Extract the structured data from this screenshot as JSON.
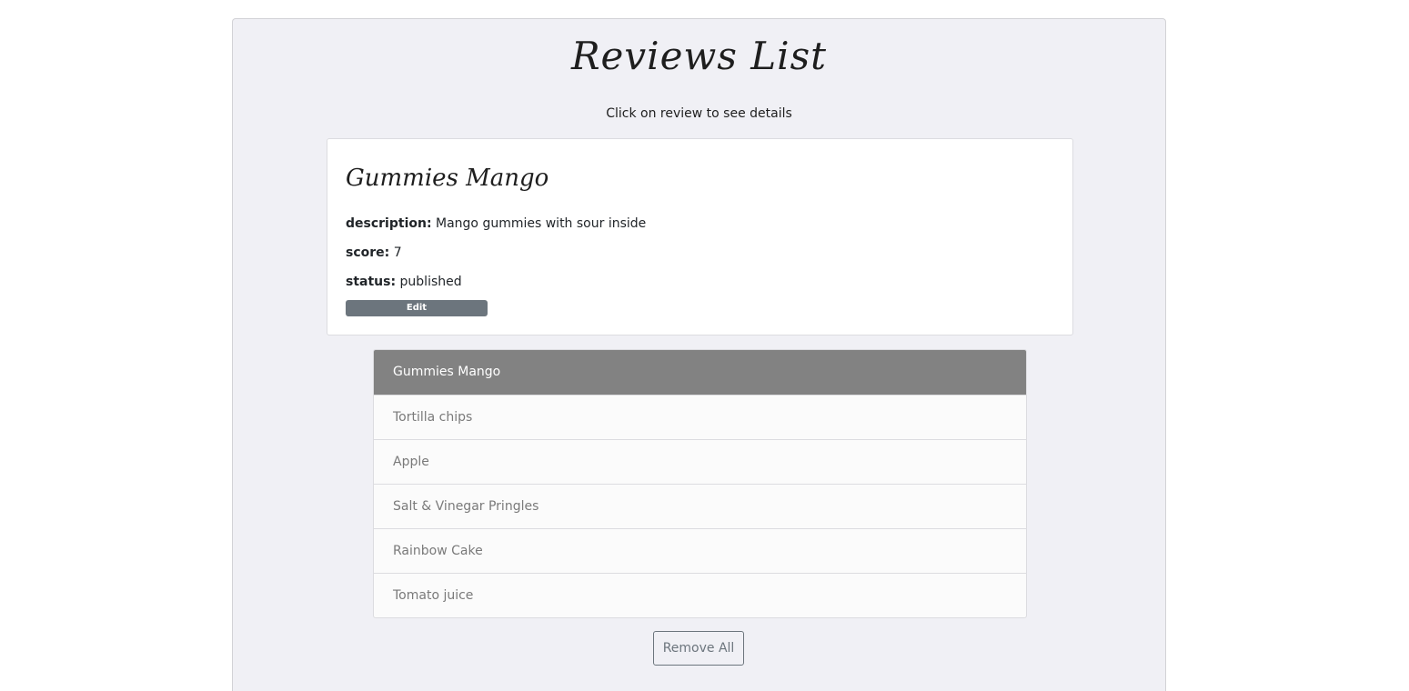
{
  "header": {
    "title": "Reviews List",
    "subtitle": "Click on review to see details"
  },
  "detail": {
    "name": "Gummies Mango",
    "description_label": "description:",
    "description": "Mango gummies with sour inside",
    "score_label": "score:",
    "score": "7",
    "status_label": "status:",
    "status": "published",
    "edit_label": "Edit"
  },
  "reviews": [
    {
      "label": "Gummies Mango",
      "active": true
    },
    {
      "label": "Tortilla chips",
      "active": false
    },
    {
      "label": "Apple",
      "active": false
    },
    {
      "label": "Salt & Vinegar Pringles",
      "active": false
    },
    {
      "label": "Rainbow Cake",
      "active": false
    },
    {
      "label": "Tomato juice",
      "active": false
    }
  ],
  "actions": {
    "remove_all_label": "Remove All"
  },
  "colors": {
    "active_item_bg": "#828282",
    "edit_button_bg": "#6c757d",
    "panel_bg": "#f0f0f5"
  }
}
